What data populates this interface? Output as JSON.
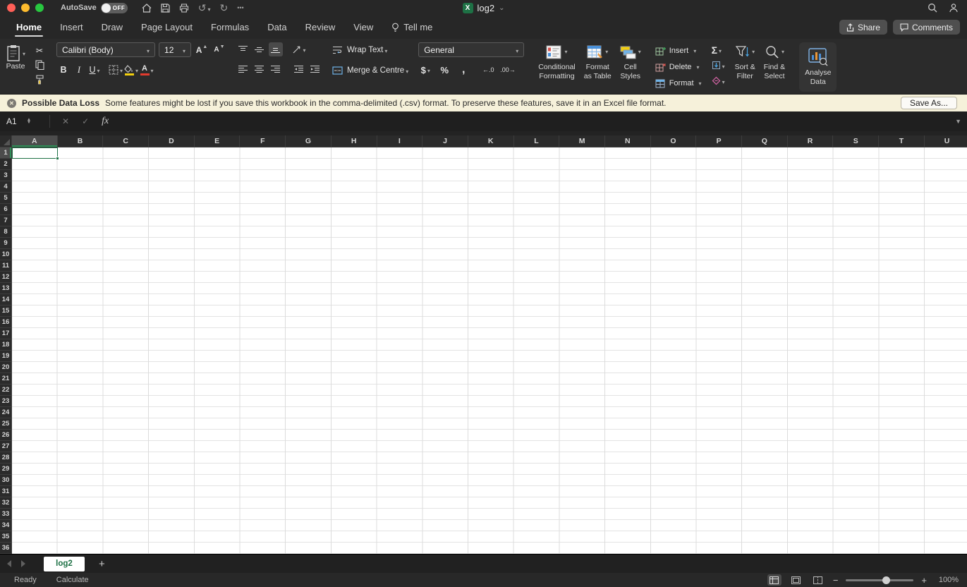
{
  "window": {
    "title": "log2",
    "autosave_label": "AutoSave",
    "autosave_state": "OFF"
  },
  "ribbon_tabs": [
    {
      "label": "Home",
      "active": true
    },
    {
      "label": "Insert",
      "active": false
    },
    {
      "label": "Draw",
      "active": false
    },
    {
      "label": "Page Layout",
      "active": false
    },
    {
      "label": "Formulas",
      "active": false
    },
    {
      "label": "Data",
      "active": false
    },
    {
      "label": "Review",
      "active": false
    },
    {
      "label": "View",
      "active": false
    },
    {
      "label": "Tell me",
      "active": false
    }
  ],
  "header_actions": {
    "share": "Share",
    "comments": "Comments"
  },
  "toolbar": {
    "paste": "Paste",
    "font_name": "Calibri (Body)",
    "font_size": "12",
    "bold": "B",
    "italic": "I",
    "underline": "U",
    "wrap_text": "Wrap Text",
    "merge_centre": "Merge & Centre",
    "number_format": "General",
    "currency": "$",
    "percent": "%",
    "comma": ",",
    "autosum": "Σ",
    "conditional_formatting": [
      "Conditional",
      "Formatting"
    ],
    "format_as_table": [
      "Format",
      "as Table"
    ],
    "cell_styles": [
      "Cell",
      "Styles"
    ],
    "insert": "Insert",
    "delete": "Delete",
    "format": "Format",
    "sort_filter": [
      "Sort &",
      "Filter"
    ],
    "find_select": [
      "Find &",
      "Select"
    ],
    "analyse_data": [
      "Analyse",
      "Data"
    ]
  },
  "icons": {
    "scissors": "✂",
    "undo": "↺",
    "redo": "↻",
    "more": "•••",
    "font_letter": "A",
    "increase_decimal": "←.0",
    "decrease_decimal": ".00→",
    "excel_badge": "X",
    "zoom_out": "−",
    "zoom_in": "+"
  },
  "warning": {
    "title": "Possible Data Loss",
    "message": "Some features might be lost if you save this workbook in the comma-delimited (.csv) format. To preserve these features, save it in an Excel file format.",
    "action": "Save As..."
  },
  "formula_bar": {
    "name_box": "A1",
    "fx": "fx"
  },
  "grid": {
    "columns": [
      "A",
      "B",
      "C",
      "D",
      "E",
      "F",
      "G",
      "H",
      "I",
      "J",
      "K",
      "L",
      "M",
      "N",
      "O",
      "P",
      "Q",
      "R",
      "S",
      "T",
      "U"
    ],
    "row_count": 36,
    "selected_cell": "A1"
  },
  "sheet_bar": {
    "tabs": [
      {
        "label": "log2",
        "active": true
      }
    ],
    "add_label": "+"
  },
  "status_bar": {
    "ready": "Ready",
    "calculate": "Calculate",
    "zoom": "100%"
  },
  "colors": {
    "accent_green": "#1e7145",
    "traffic_close": "#ff5f57",
    "traffic_minimize": "#febc2e",
    "traffic_zoom": "#28c840",
    "banner_bg": "#f6f1da"
  }
}
